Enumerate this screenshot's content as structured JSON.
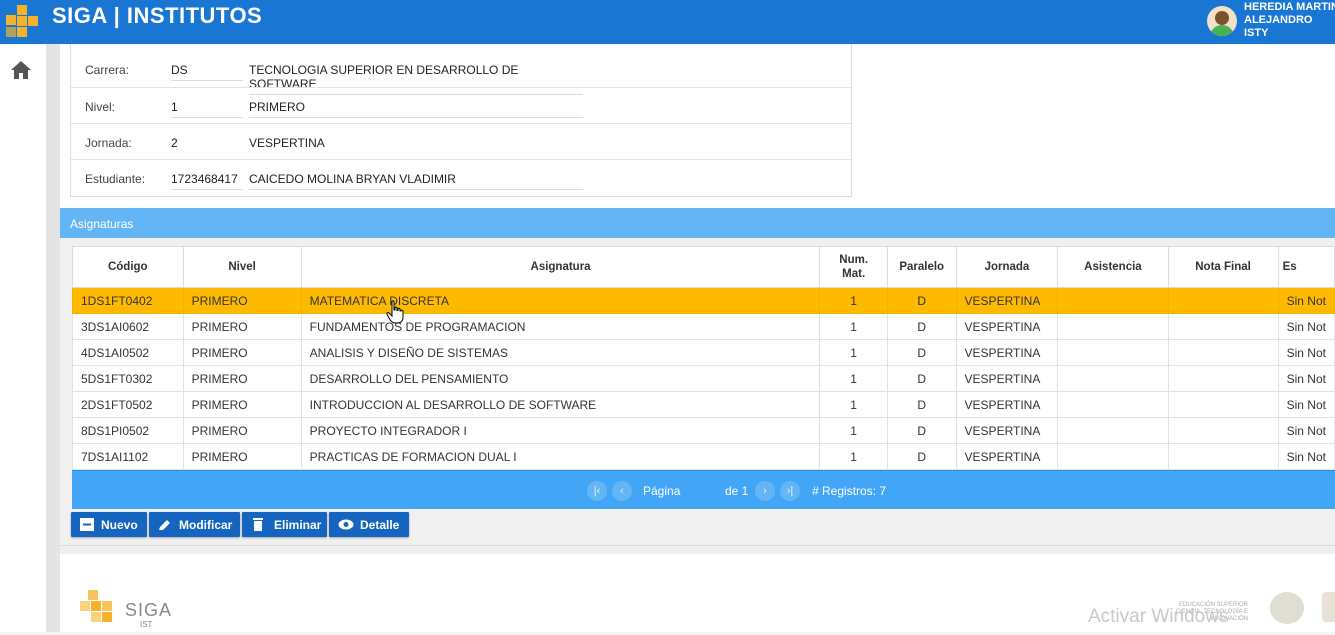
{
  "app": {
    "title": "SIGA | INSTITUTOS",
    "user_line1": "HEREDIA MARTIN",
    "user_line2": "ALEJANDRO",
    "user_line3": "ISTY"
  },
  "info": {
    "carrera_label": "Carrera:",
    "carrera_code": "DS",
    "carrera_desc": "TECNOLOGIA SUPERIOR EN DESARROLLO DE SOFTWARE",
    "nivel_label": "Nivel:",
    "nivel_code": "1",
    "nivel_desc": "PRIMERO",
    "jornada_label": "Jornada:",
    "jornada_code": "2",
    "jornada_desc": "VESPERTINA",
    "estudiante_label": "Estudiante:",
    "estudiante_code": "1723468417",
    "estudiante_desc": "CAICEDO MOLINA BRYAN VLADIMIR"
  },
  "section": {
    "title": "Asignaturas"
  },
  "grid": {
    "headers": {
      "codigo": "Código",
      "nivel": "Nivel",
      "asignatura": "Asignatura",
      "num_mat_1": "Num.",
      "num_mat_2": "Mat.",
      "paralelo": "Paralelo",
      "jornada": "Jornada",
      "asistencia": "Asistencia",
      "nota_final": "Nota Final",
      "estado": "Es"
    },
    "rows": [
      {
        "codigo": "1DS1FT0402",
        "nivel": "PRIMERO",
        "asignatura": "MATEMATICA DISCRETA",
        "num": "1",
        "paralelo": "D",
        "jornada": "VESPERTINA",
        "asistencia": "",
        "nota": "",
        "estado": "Sin Not"
      },
      {
        "codigo": "3DS1AI0602",
        "nivel": "PRIMERO",
        "asignatura": "FUNDAMENTOS DE PROGRAMACION",
        "num": "1",
        "paralelo": "D",
        "jornada": "VESPERTINA",
        "asistencia": "",
        "nota": "",
        "estado": "Sin Not"
      },
      {
        "codigo": "4DS1AI0502",
        "nivel": "PRIMERO",
        "asignatura": "ANALISIS Y DISEÑO DE SISTEMAS",
        "num": "1",
        "paralelo": "D",
        "jornada": "VESPERTINA",
        "asistencia": "",
        "nota": "",
        "estado": "Sin Not"
      },
      {
        "codigo": "5DS1FT0302",
        "nivel": "PRIMERO",
        "asignatura": "DESARROLLO DEL PENSAMIENTO",
        "num": "1",
        "paralelo": "D",
        "jornada": "VESPERTINA",
        "asistencia": "",
        "nota": "",
        "estado": "Sin Not"
      },
      {
        "codigo": "2DS1FT0502",
        "nivel": "PRIMERO",
        "asignatura": "INTRODUCCION AL DESARROLLO DE SOFTWARE",
        "num": "1",
        "paralelo": "D",
        "jornada": "VESPERTINA",
        "asistencia": "",
        "nota": "",
        "estado": "Sin Not"
      },
      {
        "codigo": "8DS1PI0502",
        "nivel": "PRIMERO",
        "asignatura": "PROYECTO INTEGRADOR I",
        "num": "1",
        "paralelo": "D",
        "jornada": "VESPERTINA",
        "asistencia": "",
        "nota": "",
        "estado": "Sin Not"
      },
      {
        "codigo": "7DS1AI1102",
        "nivel": "PRIMERO",
        "asignatura": "PRACTICAS DE FORMACION DUAL I",
        "num": "1",
        "paralelo": "D",
        "jornada": "VESPERTINA",
        "asistencia": "",
        "nota": "",
        "estado": "Sin Not"
      }
    ],
    "selected_row": 0
  },
  "pager": {
    "pagina_label": "Página",
    "page_value": "1",
    "de_label": "de 1",
    "registros": "# Registros: 7"
  },
  "buttons": {
    "nuevo": "Nuevo",
    "modificar": "Modificar",
    "eliminar": "Eliminar",
    "detalle": "Detalle"
  },
  "footer": {
    "logo_text": "SIGA",
    "logo_sub": "IST",
    "gov_line1": "EDUCACIÓN SUPERIOR",
    "gov_line2": "CIENCIA, TECNOLOGÍA E INNOVACIÓN",
    "watermark": "Activar Windows"
  },
  "colors": {
    "topbar": "#1976d2",
    "section_header": "#64b5f6",
    "selected_row": "#ffba00",
    "button": "#1565c0"
  }
}
